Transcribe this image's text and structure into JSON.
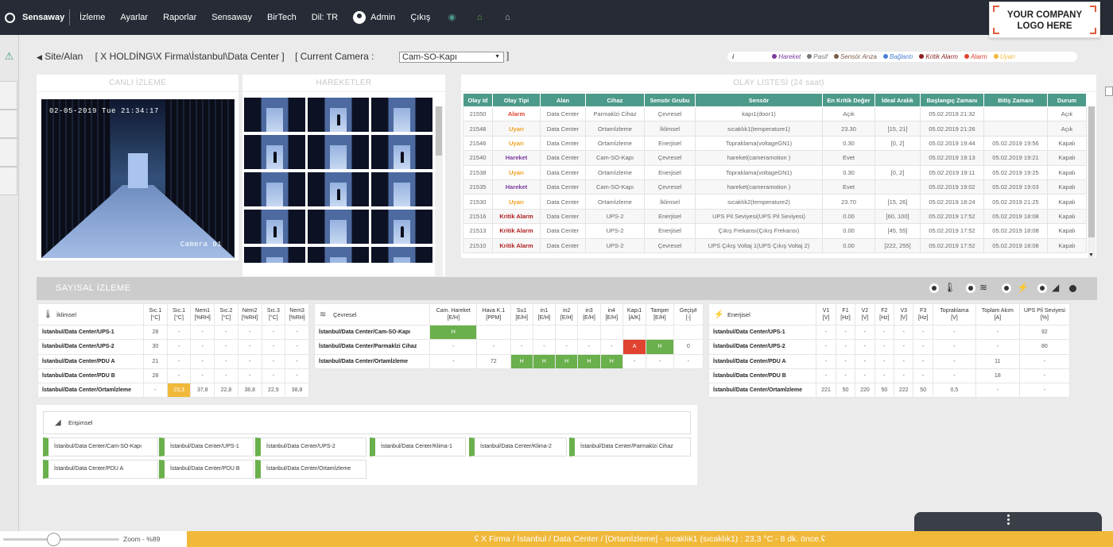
{
  "topbar": {
    "brand": "Sensaway",
    "menu": [
      "İzleme",
      "Ayarlar",
      "Raporlar",
      "Sensaway",
      "BirTech",
      "Dil: TR"
    ],
    "user": "Admin",
    "logout": "Çıkış",
    "icons": [
      "circle-target-icon",
      "home-icon",
      "home-settings-icon"
    ],
    "logo_line1": "YOUR COMPANY",
    "logo_line2": "LOGO HERE"
  },
  "breadcrumb": {
    "site": "Site/Alan",
    "path": "[ X HOLDİNG\\X Firma\\İstanbul\\Data Center ]",
    "camera_label": "[ Current Camera :",
    "camera_value": "Cam-SO-Kapı",
    "close": "]"
  },
  "legend": {
    "info": "i",
    "items": [
      {
        "label": "Hareket",
        "color": "#7b3aa0"
      },
      {
        "label": "Pasif",
        "color": "#777777"
      },
      {
        "label": "Sensör Arıza",
        "color": "#7a5a45"
      },
      {
        "label": "Bağlantı",
        "color": "#4a7fd4"
      },
      {
        "label": "Kritik Alarm",
        "color": "#8b1d1d"
      },
      {
        "label": "Alarm",
        "color": "#e0432f"
      },
      {
        "label": "Uyarı",
        "color": "#f0b93a"
      }
    ]
  },
  "live": {
    "title": "CANLI İZLEME",
    "timestamp": "02-05-2019 Tue 21:34:17",
    "camera_name": "Camera 01"
  },
  "moves": {
    "title": "HAREKETLER"
  },
  "events": {
    "title": "OLAY LİSTESİ (24 saat)",
    "headers": [
      "Olay Id",
      "Olay Tipi",
      "Alan",
      "Cihaz",
      "Sensör Grubu",
      "Sensör",
      "En Kritik Değer",
      "İdeal Aralık",
      "Başlangıç Zamanı",
      "Bitiş Zamanı",
      "Durum"
    ],
    "rows": [
      {
        "cells": [
          "21550",
          "Alarm",
          "Data Center",
          "Parmaklzi Cihaz",
          "Çevresel",
          "kapı1(door1)",
          "Açık",
          "",
          "05.02.2019 21:32",
          "",
          "Açık"
        ],
        "color": "#e0432f"
      },
      {
        "cells": [
          "21548",
          "Uyarı",
          "Data Center",
          "Ortamİzleme",
          "İklimsel",
          "sıcaklık1(temperature1)",
          "23.30",
          "[15, 21]",
          "05.02.2019 21:26",
          "",
          "Açık"
        ],
        "color": "#f0a020"
      },
      {
        "cells": [
          "21546",
          "Uyarı",
          "Data Center",
          "Ortamİzleme",
          "Enerjisel",
          "Topraklama(voltageGN1)",
          "0.30",
          "[0, 2]",
          "05.02.2019 19:44",
          "05.02.2019 19:56",
          "Kapalı"
        ],
        "color": "#f0a020"
      },
      {
        "cells": [
          "21540",
          "Hareket",
          "Data Center",
          "Cam-SO-Kapı",
          "Çevresel",
          "hareket(cameramotion )",
          "Evet",
          "",
          "05.02.2019 19:13",
          "05.02.2019 19:21",
          "Kapalı"
        ],
        "color": "#7b3aa0"
      },
      {
        "cells": [
          "21538",
          "Uyarı",
          "Data Center",
          "Ortamİzleme",
          "Enerjisel",
          "Topraklama(voltageGN1)",
          "0.30",
          "[0, 2]",
          "05.02.2019 19:11",
          "05.02.2019 19:25",
          "Kapalı"
        ],
        "color": "#f0a020"
      },
      {
        "cells": [
          "21535",
          "Hareket",
          "Data Center",
          "Cam-SO-Kapı",
          "Çevresel",
          "hareket(cameramotion )",
          "Evet",
          "",
          "05.02.2019 19:02",
          "05.02.2019 19:03",
          "Kapalı"
        ],
        "color": "#7b3aa0"
      },
      {
        "cells": [
          "21530",
          "Uyarı",
          "Data Center",
          "Ortamİzleme",
          "İklimsel",
          "sıcaklık2(temperature2)",
          "23.70",
          "[15, 26]",
          "05.02.2019 18:24",
          "05.02.2019 21:25",
          "Kapalı"
        ],
        "color": "#f0a020"
      },
      {
        "cells": [
          "21516",
          "Kritik Alarm",
          "Data Center",
          "UPS-2",
          "Enerjisel",
          "UPS Pil Seviyesi(UPS Pil Seviyesi)",
          "0.00",
          "[60, 100]",
          "05.02.2019 17:52",
          "05.02.2019 18:08",
          "Kapalı"
        ],
        "color": "#b02020"
      },
      {
        "cells": [
          "21513",
          "Kritik Alarm",
          "Data Center",
          "UPS-2",
          "Enerjisel",
          "Çıkış Frekansı(Çıkış Frekansı)",
          "0.00",
          "[45, 55]",
          "05.02.2019 17:52",
          "05.02.2019 18:08",
          "Kapalı"
        ],
        "color": "#b02020"
      },
      {
        "cells": [
          "21510",
          "Kritik Alarm",
          "Data Center",
          "UPS-2",
          "Çevresel",
          "UPS Çıkış Voltaj 1(UPS Çıkış Voltaj 2)",
          "0.00",
          "[222, 255]",
          "05.02.2019 17:52",
          "05.02.2019 18:08",
          "Kapalı"
        ],
        "color": "#b02020"
      }
    ]
  },
  "numeric": {
    "title": "SAYISAL İZLEME",
    "iklimsel": {
      "label": "İklimsel",
      "headers": [
        [
          "Sıc.1",
          "[°C]"
        ],
        [
          "Sıc.1",
          "[°C]"
        ],
        [
          "Nem1",
          "[%RH]"
        ],
        [
          "Sıc.2",
          "[°C]"
        ],
        [
          "Nem2",
          "[%RH]"
        ],
        [
          "Sıc.3",
          "[°C]"
        ],
        [
          "Nem3",
          "[%RH]"
        ]
      ],
      "rows": [
        {
          "name": "İstanbul/Data Center/UPS-1",
          "vals": [
            "28",
            "-",
            "-",
            "-",
            "-",
            "-",
            "-"
          ]
        },
        {
          "name": "İstanbul/Data Center/UPS-2",
          "vals": [
            "30",
            "-",
            "-",
            "-",
            "-",
            "-",
            "-"
          ]
        },
        {
          "name": "İstanbul/Data Center/PDU A",
          "vals": [
            "21",
            "-",
            "-",
            "-",
            "-",
            "-",
            "-"
          ]
        },
        {
          "name": "İstanbul/Data Center/PDU B",
          "vals": [
            "28",
            "-",
            "-",
            "-",
            "-",
            "-",
            "-"
          ]
        },
        {
          "name": "İstanbul/Data Center/Ortamİzleme",
          "vals": [
            "-",
            "23,3",
            "37,8",
            "22,8",
            "38,8",
            "22,9",
            "38,8"
          ],
          "hl": {
            "1": "y"
          }
        }
      ]
    },
    "cevresel": {
      "label": "Çevresel",
      "headers": [
        [
          "Cam. Hareket",
          "[E/H]"
        ],
        [
          "Hava K.1",
          "[PPM]"
        ],
        [
          "Su1",
          "[E/H]"
        ],
        [
          "in1",
          "[E/H]"
        ],
        [
          "in2",
          "[E/H]"
        ],
        [
          "in3",
          "[E/H]"
        ],
        [
          "in4",
          "[E/H]"
        ],
        [
          "Kapı1",
          "[A/K]"
        ],
        [
          "Tamper",
          "[E/H]"
        ],
        [
          "Geçiş#",
          "[-]"
        ]
      ],
      "rows": [
        {
          "name": "İstanbul/Data Center/Cam-SO-Kapı",
          "vals": [
            "H",
            "",
            "",
            "",
            "",
            "",
            "",
            "",
            "",
            ""
          ],
          "hl": {
            "0": "g"
          }
        },
        {
          "name": "İstanbul/Data Center/Parmaklzi Cihaz",
          "vals": [
            "-",
            "-",
            "-",
            "-",
            "-",
            "-",
            "-",
            "A",
            "H",
            "0"
          ],
          "hl": {
            "7": "r",
            "8": "g"
          }
        },
        {
          "name": "İstanbul/Data Center/Ortamİzleme",
          "vals": [
            "-",
            "72",
            "H",
            "H",
            "H",
            "H",
            "H",
            "-",
            "-",
            "-"
          ],
          "hl": {
            "2": "g",
            "3": "g",
            "4": "g",
            "5": "g",
            "6": "g"
          }
        }
      ]
    },
    "enerjisel": {
      "label": "Enerjisel",
      "headers": [
        [
          "V1",
          "[V]"
        ],
        [
          "F1",
          "[Hz]"
        ],
        [
          "V2",
          "[V]"
        ],
        [
          "F2",
          "[Hz]"
        ],
        [
          "V3",
          "[V]"
        ],
        [
          "F3",
          "[Hz]"
        ],
        [
          "Topraklama",
          "[V]"
        ],
        [
          "Toplam Akım",
          "[A]"
        ],
        [
          "UPS Pil Seviyesi",
          "[%]"
        ]
      ],
      "rows": [
        {
          "name": "İstanbul/Data Center/UPS-1",
          "vals": [
            "-",
            "-",
            "-",
            "-",
            "-",
            "-",
            "-",
            "-",
            "92"
          ]
        },
        {
          "name": "İstanbul/Data Center/UPS-2",
          "vals": [
            "-",
            "-",
            "-",
            "-",
            "-",
            "-",
            "-",
            "-",
            "80"
          ]
        },
        {
          "name": "İstanbul/Data Center/PDU A",
          "vals": [
            "-",
            "-",
            "-",
            "-",
            "-",
            "-",
            "-",
            "11",
            "-"
          ]
        },
        {
          "name": "İstanbul/Data Center/PDU B",
          "vals": [
            "-",
            "-",
            "-",
            "-",
            "-",
            "-",
            "-",
            "18",
            "-"
          ]
        },
        {
          "name": "İstanbul/Data Center/Ortamİzleme",
          "vals": [
            "221",
            "50",
            "220",
            "50",
            "222",
            "50",
            "0,5",
            "-",
            "-"
          ]
        }
      ]
    },
    "erisimsel": {
      "label": "Erişimsel",
      "items": [
        "İstanbul/Data Center/Cam-SO-Kapı",
        "İstanbul/Data Center/UPS-1",
        "İstanbul/Data Center/UPS-2",
        "İstanbul/Data Center/Klima-1",
        "İstanbul/Data Center/Klima-2",
        "İstanbul/Data Center/Parmaklzi Cihaz",
        "İstanbul/Data Center/PDU A",
        "İstanbul/Data Center/PDU B",
        "İstanbul/Data Center/Ortamİzleme"
      ]
    }
  },
  "footer": {
    "zoom": "Zoom - %89",
    "zoom_level": 0.89,
    "ticker": "ʢ X Firma / İstanbul / Data Center / [Ortamİzleme] - sıcaklık1 (sıcaklık1) : 23,3 °C - 8 dk. önce.ʢ"
  }
}
